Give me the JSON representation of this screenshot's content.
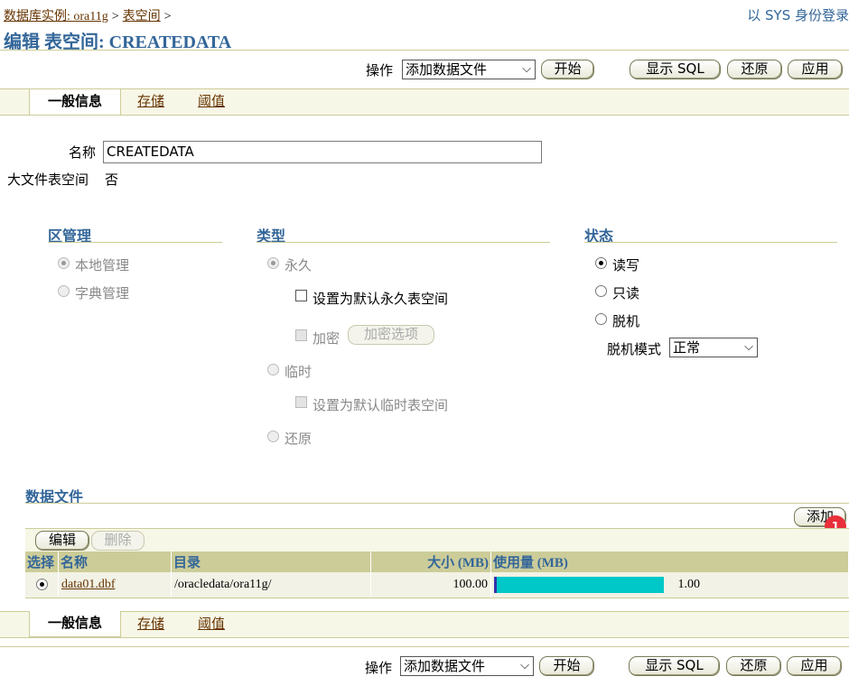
{
  "breadcrumb": {
    "items": [
      "数据库实例: ora11g",
      "表空间"
    ],
    "separator": ">"
  },
  "login_link": "以 SYS 身份登录",
  "page_title": "编辑 表空间: CREATEDATA",
  "toolbar": {
    "action_label": "操作",
    "action_value": "添加数据文件",
    "start_button": "开始",
    "show_sql_button": "显示 SQL",
    "revert_button": "还原",
    "apply_button": "应用"
  },
  "tabs": {
    "general": "一般信息",
    "storage": "存储",
    "threshold": "阈值"
  },
  "general": {
    "name_label": "名称",
    "name_value": "CREATEDATA",
    "bigfile_label": "大文件表空间",
    "bigfile_value": "否"
  },
  "extent_management": {
    "heading": "区管理",
    "local": "本地管理",
    "dictionary": "字典管理"
  },
  "type": {
    "heading": "类型",
    "permanent": "永久",
    "default_permanent": "设置为默认永久表空间",
    "encrypt": "加密",
    "encrypt_options": "加密选项",
    "temporary": "临时",
    "default_temporary": "设置为默认临时表空间",
    "undo": "还原"
  },
  "status": {
    "heading": "状态",
    "read_write": "读写",
    "read_only": "只读",
    "offline": "脱机",
    "offline_mode_label": "脱机模式",
    "offline_mode_value": "正常"
  },
  "datafiles": {
    "heading": "数据文件",
    "add_button": "添加",
    "badge": "1",
    "edit_button": "编辑",
    "delete_button": "删除",
    "columns": {
      "select": "选择",
      "name": "名称",
      "directory": "目录",
      "size": "大小 (MB)",
      "usage": "使用量 (MB)"
    },
    "rows": [
      {
        "name": "data01.dbf",
        "directory": "/oracledata/ora11g/",
        "size": "100.00",
        "usage": "1.00",
        "usage_fraction": 0.01
      }
    ]
  },
  "colors": {
    "heading": "#336699",
    "link": "#663300",
    "table_header": "#cccc99",
    "usage_bar": "#00c8c8"
  }
}
